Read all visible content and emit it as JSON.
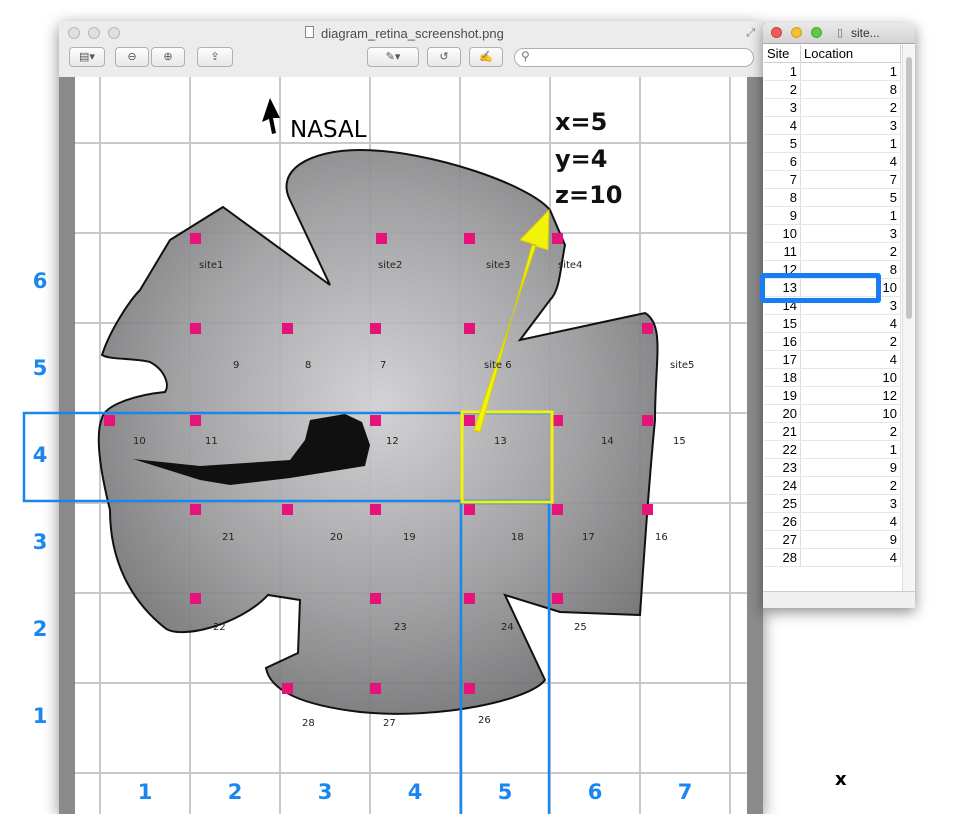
{
  "main_window": {
    "title": "diagram_retina_screenshot.png"
  },
  "side_window": {
    "title": "site...",
    "columns": [
      "Site",
      "Location"
    ],
    "rows": [
      [
        "1",
        "1"
      ],
      [
        "2",
        "8"
      ],
      [
        "3",
        "2"
      ],
      [
        "4",
        "3"
      ],
      [
        "5",
        "1"
      ],
      [
        "6",
        "4"
      ],
      [
        "7",
        "7"
      ],
      [
        "8",
        "5"
      ],
      [
        "9",
        "1"
      ],
      [
        "10",
        "3"
      ],
      [
        "11",
        "2"
      ],
      [
        "12",
        "8"
      ],
      [
        "13",
        "10"
      ],
      [
        "14",
        "3"
      ],
      [
        "15",
        "4"
      ],
      [
        "16",
        "2"
      ],
      [
        "17",
        "4"
      ],
      [
        "18",
        "10"
      ],
      [
        "19",
        "12"
      ],
      [
        "20",
        "10"
      ],
      [
        "21",
        "2"
      ],
      [
        "22",
        "1"
      ],
      [
        "23",
        "9"
      ],
      [
        "24",
        "2"
      ],
      [
        "25",
        "3"
      ],
      [
        "26",
        "4"
      ],
      [
        "27",
        "9"
      ],
      [
        "28",
        "4"
      ]
    ]
  },
  "diagram": {
    "orientation_label": "NASAL",
    "annotation": [
      "x=5",
      "y=4",
      "z=10"
    ],
    "site_labels": [
      "site1",
      "site2",
      "site3",
      "site4",
      "site5",
      "site 6"
    ],
    "numbers": [
      "9",
      "8",
      "7",
      "10",
      "11",
      "12",
      "13",
      "14",
      "15",
      "21",
      "20",
      "19",
      "18",
      "17",
      "16",
      "22",
      "23",
      "24",
      "25",
      "28",
      "27",
      "26"
    ],
    "x_axis_labels": [
      "1",
      "2",
      "3",
      "4",
      "5",
      "6",
      "7"
    ],
    "y_axis_labels": [
      "6",
      "5",
      "4",
      "3",
      "2",
      "1"
    ],
    "corner_label": "x"
  },
  "colors": {
    "marker": "#e6137a",
    "blue_highlight": "#1a86f0",
    "yellow_highlight": "#f2f20a",
    "retina_fill": "#8d8d8d"
  }
}
